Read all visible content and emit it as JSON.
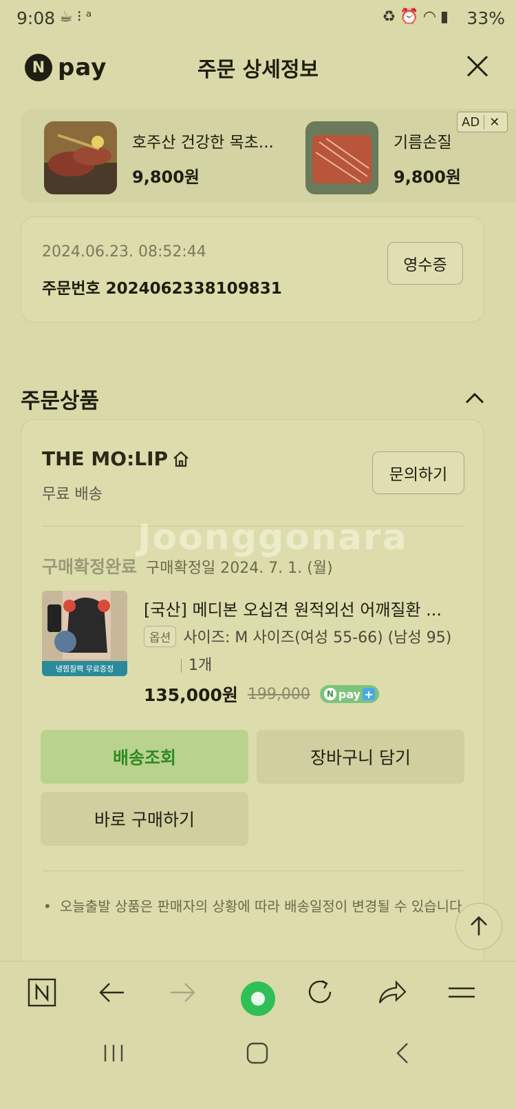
{
  "status_bar": {
    "time": "9:08",
    "battery": "33%",
    "left_icons": [
      "cup-icon",
      "dots-icon",
      "gesture-icon"
    ],
    "right_icons": [
      "battery-saver-icon",
      "alarm-icon",
      "wifi-icon",
      "signal-icon"
    ]
  },
  "header": {
    "logo_mark": "N",
    "logo_text": "pay",
    "title": "주문 상세정보"
  },
  "ads": {
    "badge": "AD",
    "items": [
      {
        "name": "호주산 건강한 목초...",
        "price": "9,800원"
      },
      {
        "name": "기름손질",
        "price": "9,800원"
      }
    ]
  },
  "order": {
    "datetime": "2024.06.23. 08:52:44",
    "order_number": "주문번호 2024062338109831",
    "receipt_button": "영수증"
  },
  "section": {
    "title": "주문상품"
  },
  "shop": {
    "name": "THE MO:LIP",
    "shipping": "무료 배송",
    "inquiry_button": "문의하기"
  },
  "item": {
    "status": "구매확정완료",
    "confirm_date": "구매확정일 2024. 7. 1. (월)",
    "thumb_caption": "냉찜질팩 무료증정",
    "name": "[국산] 메디본 오십견 원적외선 어깨질환 ...",
    "option_tag": "옵션",
    "option_value": "사이즈: M 사이즈(여성 55-66) (남성 95)",
    "quantity": "1개",
    "price": "135,000원",
    "original_price": "199,000",
    "npay_badge_text": "pay"
  },
  "actions": {
    "track": "배송조회",
    "cart": "장바구니 담기",
    "buy_now": "바로 구매하기"
  },
  "notice": "오늘출발 상품은 판매자의 상황에 따라 배송일정이 변경될 수 있습니다.",
  "watermark": "Joonggonara",
  "colors": {
    "background": "#d9d9a9",
    "accent_green": "#2fbf56",
    "track_button_bg": "#b9d38f",
    "track_button_text": "#2f8a22"
  }
}
